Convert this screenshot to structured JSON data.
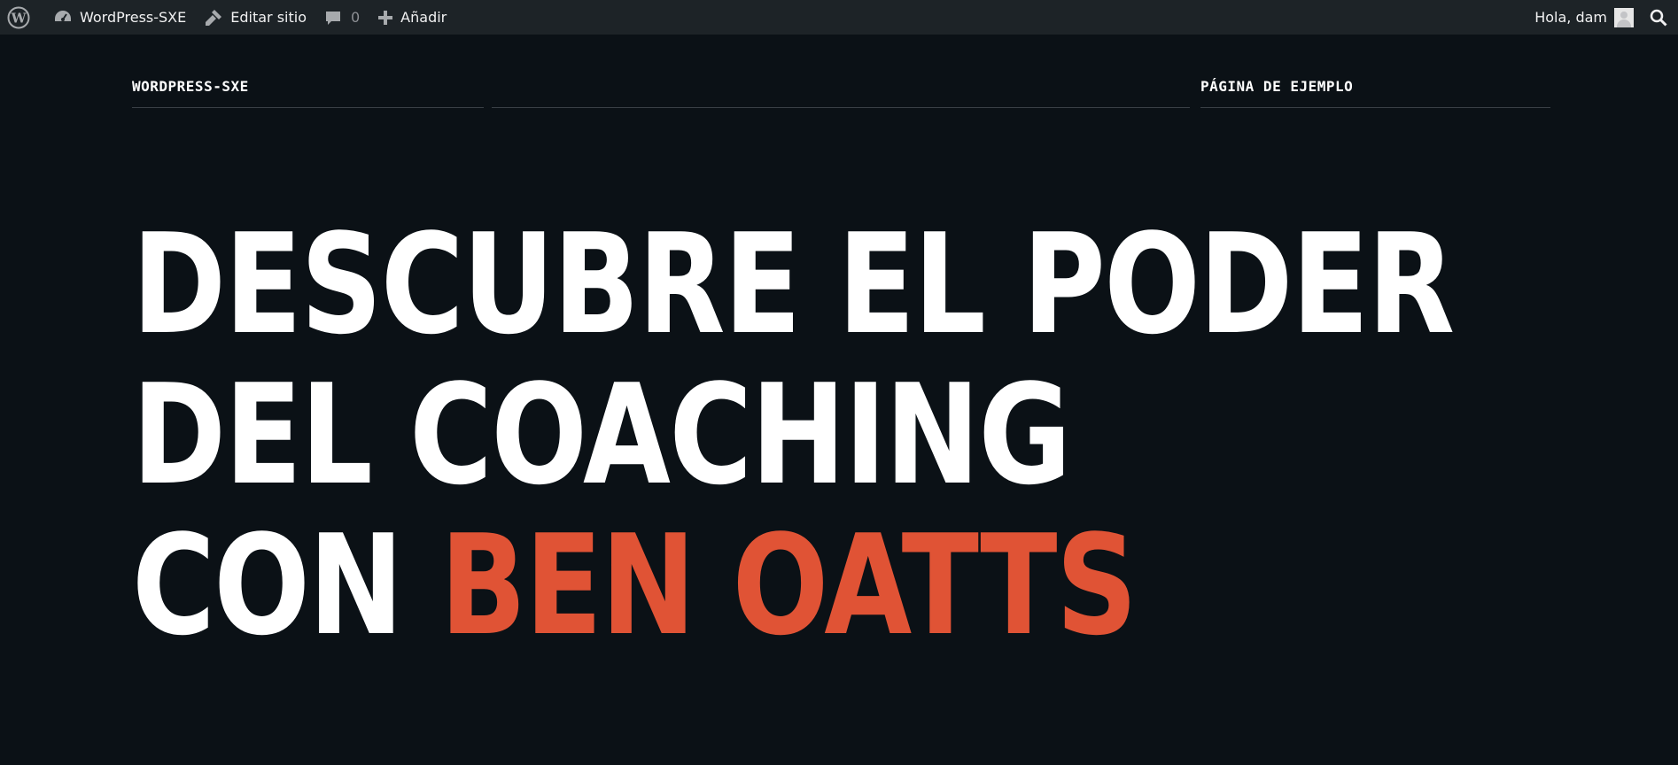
{
  "admin_bar": {
    "site_name": "WordPress-SXE",
    "edit_site": "Editar sitio",
    "comments_count": "0",
    "add_new": "Añadir",
    "greeting": "Hola, dam"
  },
  "header": {
    "site_title": "WORDPRESS-SXE",
    "nav_link": "PÁGINA DE EJEMPLO"
  },
  "hero": {
    "line1": "DESCUBRE EL PODER",
    "line2": "DEL COACHING",
    "line3_prefix": "CON ",
    "line3_accent": "BEN OATTS"
  },
  "colors": {
    "background": "#0b1116",
    "admin_bar": "#1d2327",
    "accent": "#e05335",
    "text": "#ffffff"
  }
}
